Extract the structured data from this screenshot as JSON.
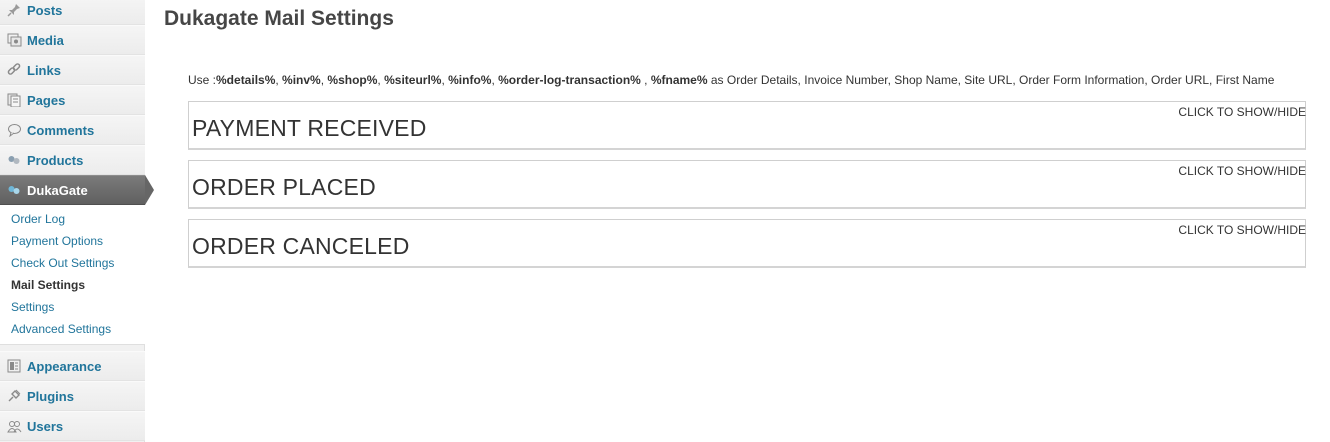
{
  "sidebar": {
    "menu": [
      {
        "label": "Posts",
        "icon": "pin-icon"
      },
      {
        "label": "Media",
        "icon": "media-icon"
      },
      {
        "label": "Links",
        "icon": "link-icon"
      },
      {
        "label": "Pages",
        "icon": "pages-icon"
      },
      {
        "label": "Comments",
        "icon": "comment-icon"
      },
      {
        "label": "Products",
        "icon": "products-icon"
      },
      {
        "label": "DukaGate",
        "icon": "dukagate-icon"
      },
      {
        "label": "Appearance",
        "icon": "appearance-icon"
      },
      {
        "label": "Plugins",
        "icon": "plugin-icon"
      },
      {
        "label": "Users",
        "icon": "users-icon"
      }
    ],
    "submenu": [
      "Order Log",
      "Payment Options",
      "Check Out Settings",
      "Mail Settings",
      "Settings",
      "Advanced Settings"
    ],
    "active_submenu": "Mail Settings"
  },
  "main": {
    "title": "Dukagate Mail Settings",
    "usage": {
      "prefix": "Use :",
      "codes": [
        "%details%",
        "%inv%",
        "%shop%",
        "%siteurl%",
        "%info%",
        "%order-log-transaction%",
        "%fname%"
      ],
      "suffix": " as Order Details, Invoice Number, Shop Name, Site URL, Order Form Information, Order URL, First Name"
    },
    "panels": [
      {
        "title": "PAYMENT RECEIVED",
        "toggle": "CLICK TO SHOW/HIDE"
      },
      {
        "title": "ORDER PLACED",
        "toggle": "CLICK TO SHOW/HIDE"
      },
      {
        "title": "ORDER CANCELED",
        "toggle": "CLICK TO SHOW/HIDE"
      }
    ]
  },
  "colors": {
    "link": "#21759b",
    "current_menu_bg": "#666666"
  }
}
